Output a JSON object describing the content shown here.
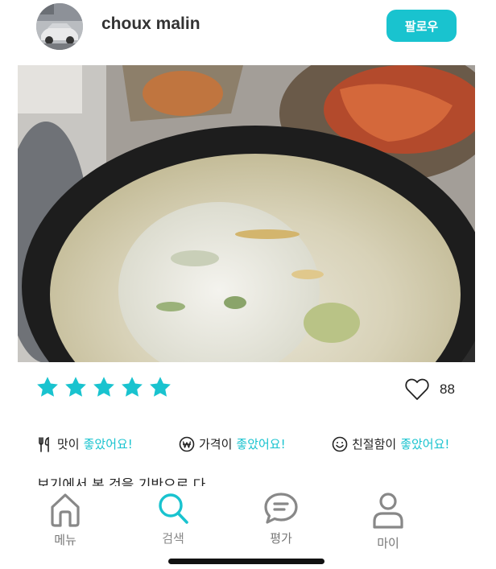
{
  "profile": {
    "username": "choux malin",
    "follow_label": "팔로우",
    "avatar_icon": "car-photo-avatar"
  },
  "post": {
    "photo_icon": "food-photo",
    "rating": 5,
    "rating_max": 5,
    "like_count": "88",
    "accent_color": "#19c3cf",
    "tags": [
      {
        "icon": "utensils-icon",
        "label": "맛이",
        "value": "좋았어요!"
      },
      {
        "icon": "won-icon",
        "label": "가격이",
        "value": "좋았어요!"
      },
      {
        "icon": "smile-icon",
        "label": "친절함이",
        "value": "좋았어요!"
      }
    ],
    "review_text": "보기에서 본 것을 기반으로 다"
  },
  "tabbar": {
    "tabs": [
      {
        "label": "메뉴",
        "icon": "home-icon"
      },
      {
        "label": "검색",
        "icon": "search-icon",
        "active": true
      },
      {
        "label": "평가",
        "icon": "chat-icon"
      },
      {
        "label": "마이",
        "icon": "person-icon"
      }
    ]
  }
}
